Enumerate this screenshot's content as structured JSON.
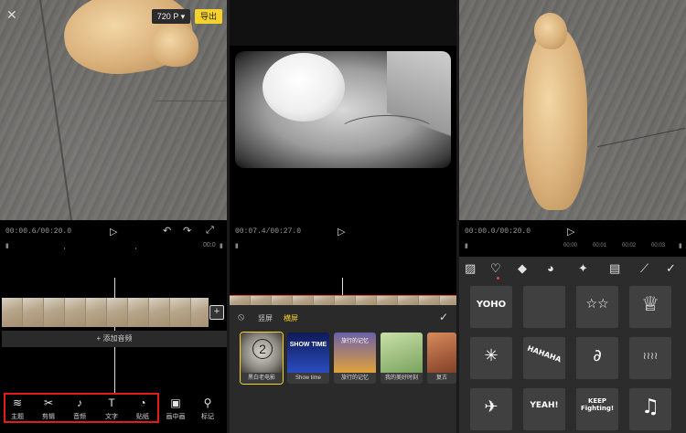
{
  "panel1": {
    "resolution": "720 P",
    "resolution_arrow": "▾",
    "export_label": "导出",
    "timecode": "00:00.6/00:20.0",
    "ruler_marks": [
      "00:0"
    ],
    "add_audio_label": "+ 添加音频",
    "toolbar": [
      {
        "icon": "≋",
        "label": "主题"
      },
      {
        "icon": "✂",
        "label": "剪辑"
      },
      {
        "icon": "♪",
        "label": "音频"
      },
      {
        "icon": "T",
        "label": "文字"
      },
      {
        "icon": "◔",
        "label": "贴纸"
      },
      {
        "icon": "▣",
        "label": "画中画"
      },
      {
        "icon": "⚲",
        "label": "标记"
      }
    ]
  },
  "panel2": {
    "timecode": "00:07.4/00:27.0",
    "tab_vertical": "竖屏",
    "tab_horizontal": "横屏",
    "effects": [
      {
        "label": "黑白老电影",
        "selected": true,
        "color": "#5c5a54"
      },
      {
        "label": "Show time",
        "selected": false,
        "color": "#1e2f8a"
      },
      {
        "label": "旅行的记忆",
        "selected": false,
        "color": "#e0a33a"
      },
      {
        "label": "我的美好时刻",
        "selected": false,
        "color": "#8fbf72"
      },
      {
        "label": "复古",
        "selected": false,
        "color": "#b85b3c"
      }
    ],
    "card_overlays": [
      "2",
      "SHOW TIME",
      "旅行的记忆",
      "",
      ""
    ]
  },
  "panel3": {
    "timecode": "00:00.0/00:20.0",
    "ruler_marks": [
      "00:00",
      "00:01",
      "00:02",
      "00:03"
    ],
    "sticker_tabs": [
      "image-icon",
      "heart-icon",
      "cat-icon",
      "dog-icon",
      "sparkle-icon",
      "camera-icon",
      "pen-icon",
      "check-icon"
    ],
    "stickers": [
      "YOHO",
      "",
      "☆☆",
      "♕",
      "✳",
      "HAHAHA",
      "∂",
      "≀≀≀≀",
      "✈",
      "YEAH!",
      "KEEP Fighting!",
      "♫"
    ]
  },
  "colors": {
    "accent": "#f7d22b",
    "highlight": "#e01b1b",
    "sheet": "#2a2a2a"
  }
}
